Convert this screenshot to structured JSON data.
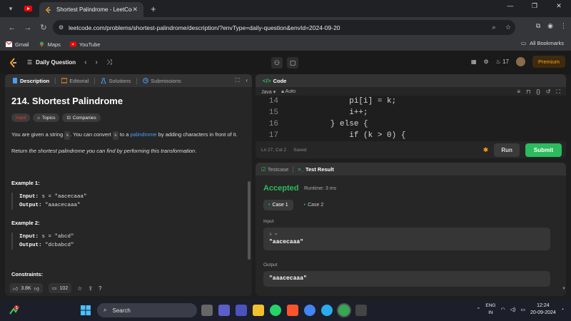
{
  "browser": {
    "tab_title": "Shortest Palindrome - LeetCode",
    "url": "leetcode.com/problems/shortest-palindrome/description/?envType=daily-question&envId=2024-09-20",
    "bookmarks": [
      "Gmail",
      "Maps",
      "YouTube"
    ],
    "all_bookmarks": "All Bookmarks"
  },
  "leetcode": {
    "daily_question": "Daily Question",
    "streak": "17",
    "premium": "Premium"
  },
  "left": {
    "tabs": [
      "Description",
      "Editorial",
      "Solutions",
      "Submissions"
    ],
    "title": "214. Shortest Palindrome",
    "difficulty": "Hard",
    "chips": [
      "Topics",
      "Companies"
    ],
    "desc_1a": "You are given a string ",
    "desc_1_s": "s",
    "desc_1b": ". You can convert ",
    "desc_1c": " to a ",
    "desc_1_link": "palindrome",
    "desc_1d": " by adding characters in front of it.",
    "desc_2a": "Return ",
    "desc_2_em": "the shortest palindrome you can find by performing this transformation",
    "desc_2b": ".",
    "ex1_title": "Example 1:",
    "ex1_input": "s = \"aacecaaa\"",
    "ex1_output": "\"aaacecaaa\"",
    "ex2_title": "Example 2:",
    "ex2_input": "s = \"abcd\"",
    "ex2_output": "\"dcbabcd\"",
    "input_label": "Input:",
    "output_label": "Output:",
    "constraints": "Constraints:",
    "likes": "3.8K",
    "comments": "102"
  },
  "code": {
    "title": "Code",
    "lang": "Java",
    "auto": "Auto",
    "lines": [
      {
        "n": "14",
        "t": "            pi[i] = k;"
      },
      {
        "n": "15",
        "t": "            i++;"
      },
      {
        "n": "16",
        "t": "        } else {"
      },
      {
        "n": "17",
        "t": "            if (k > 0) {"
      }
    ],
    "cursor": "Ln 27, Col 2",
    "saved": "Saved",
    "run": "Run",
    "submit": "Submit"
  },
  "test": {
    "tabs": [
      "Testcase",
      "Test Result"
    ],
    "status": "Accepted",
    "runtime": "Runtime: 3 ms",
    "cases": [
      "Case 1",
      "Case 2"
    ],
    "input_label": "Input",
    "var_name": "s =",
    "input_value": "\"aacecaaa\"",
    "output_label": "Output",
    "output_value": "\"aaacecaaa\""
  },
  "taskbar": {
    "search": "Search",
    "lang1": "ENG",
    "lang2": "IN",
    "time": "12:24",
    "date": "20-09-2024",
    "notif": "1"
  }
}
